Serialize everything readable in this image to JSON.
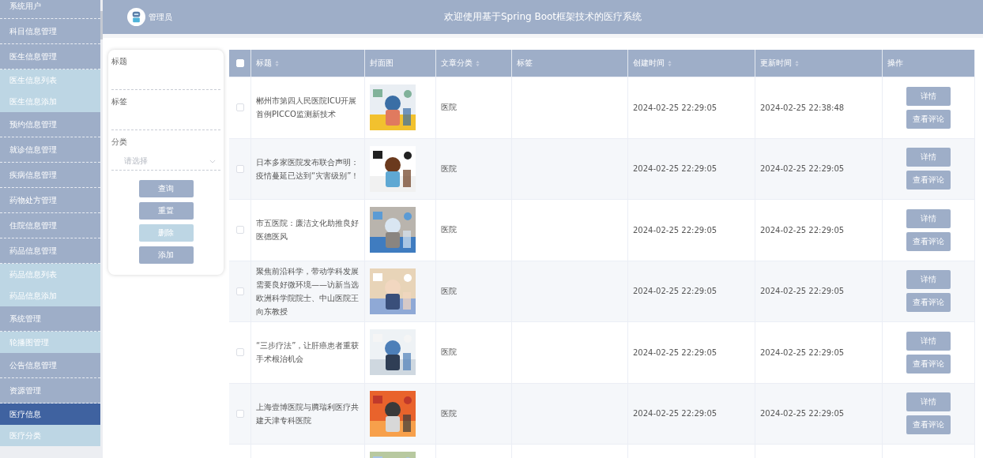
{
  "sidebar": {
    "items": [
      {
        "label": "系统用户",
        "kind": "group",
        "selected": false
      },
      {
        "label": "科目信息管理",
        "kind": "group",
        "selected": false
      },
      {
        "label": "医生信息管理",
        "kind": "group",
        "selected": false
      },
      {
        "label": "医生信息列表",
        "kind": "sub",
        "selected": false
      },
      {
        "label": "医生信息添加",
        "kind": "sub",
        "selected": false
      },
      {
        "label": "预约信息管理",
        "kind": "group",
        "selected": false
      },
      {
        "label": "就诊信息管理",
        "kind": "group",
        "selected": false
      },
      {
        "label": "疾病信息管理",
        "kind": "group",
        "selected": false
      },
      {
        "label": "药物处方管理",
        "kind": "group",
        "selected": false
      },
      {
        "label": "住院信息管理",
        "kind": "group",
        "selected": false
      },
      {
        "label": "药品信息管理",
        "kind": "group",
        "selected": false
      },
      {
        "label": "药品信息列表",
        "kind": "sub",
        "selected": false
      },
      {
        "label": "药品信息添加",
        "kind": "sub",
        "selected": false
      },
      {
        "label": "系统管理",
        "kind": "group",
        "selected": false
      },
      {
        "label": "轮播图管理",
        "kind": "sub",
        "selected": false
      },
      {
        "label": "公告信息管理",
        "kind": "group",
        "selected": false
      },
      {
        "label": "资源管理",
        "kind": "group",
        "selected": false
      },
      {
        "label": "医疗信息",
        "kind": "sub",
        "selected": true
      },
      {
        "label": "医疗分类",
        "kind": "sub",
        "selected": false
      }
    ]
  },
  "header": {
    "user": "管理员",
    "title": "欢迎使用基于Spring Boot框架技术的医疗系统"
  },
  "filter": {
    "fields": [
      {
        "label": "标题",
        "kind": "input"
      },
      {
        "label": "标签",
        "kind": "input"
      },
      {
        "label": "分类",
        "kind": "select",
        "placeholder": "请选择"
      }
    ],
    "buttons": [
      {
        "label": "查询",
        "disabled": false
      },
      {
        "label": "重置",
        "disabled": false
      },
      {
        "label": "删除",
        "disabled": true
      },
      {
        "label": "添加",
        "disabled": false
      }
    ]
  },
  "table": {
    "select_all": {
      "checked": false
    },
    "columns": [
      {
        "label": "标题",
        "sortable": true
      },
      {
        "label": "封面图",
        "sortable": false
      },
      {
        "label": "文章分类",
        "sortable": true
      },
      {
        "label": "标签",
        "sortable": false
      },
      {
        "label": "创建时间",
        "sortable": true
      },
      {
        "label": "更新时间",
        "sortable": true
      },
      {
        "label": "操作",
        "sortable": false
      }
    ],
    "rows": [
      {
        "checked": false,
        "title": "郴州市第四人民医院ICU开展首例PICCO监测新技术",
        "cover": {
          "kind": "picture"
        },
        "category": "医院",
        "created": "2024-02-25 22:29:05",
        "updated": "2024-02-25 22:38:48",
        "actions": [
          "详情",
          "查看评论"
        ]
      },
      {
        "checked": false,
        "title": "日本多家医院发布联合声明：疫情蔓延已达到“灾害级别”！",
        "cover": {
          "kind": "picture"
        },
        "category": "医院",
        "created": "2024-02-25 22:29:05",
        "updated": "2024-02-25 22:29:05",
        "actions": [
          "详情",
          "查看评论"
        ]
      },
      {
        "checked": false,
        "title": "市五医院：廉洁文化助推良好医德医风",
        "cover": {
          "kind": "picture"
        },
        "category": "医院",
        "created": "2024-02-25 22:29:05",
        "updated": "2024-02-25 22:29:05",
        "actions": [
          "详情",
          "查看评论"
        ]
      },
      {
        "checked": false,
        "title": "聚焦前沿科学，带动学科发展需要良好微环境——访新当选欧洲科学院院士、中山医院王向东教授",
        "cover": {
          "kind": "picture"
        },
        "category": "医院",
        "created": "2024-02-25 22:29:05",
        "updated": "2024-02-25 22:29:05",
        "actions": [
          "详情",
          "查看评论"
        ]
      },
      {
        "checked": false,
        "title": "“三步疗法”，让肝癌患者重获手术根治机会",
        "cover": {
          "kind": "picture"
        },
        "category": "医院",
        "created": "2024-02-25 22:29:05",
        "updated": "2024-02-25 22:29:05",
        "actions": [
          "详情",
          "查看评论"
        ]
      },
      {
        "checked": false,
        "title": "上海壹博医院与腾瑞利医疗共建天津专科医院",
        "cover": {
          "kind": "picture"
        },
        "category": "医院",
        "created": "2024-02-25 22:29:05",
        "updated": "2024-02-25 22:29:05",
        "actions": [
          "详情",
          "查看评论"
        ]
      },
      {
        "cover": {
          "kind": "picture"
        }
      }
    ]
  }
}
